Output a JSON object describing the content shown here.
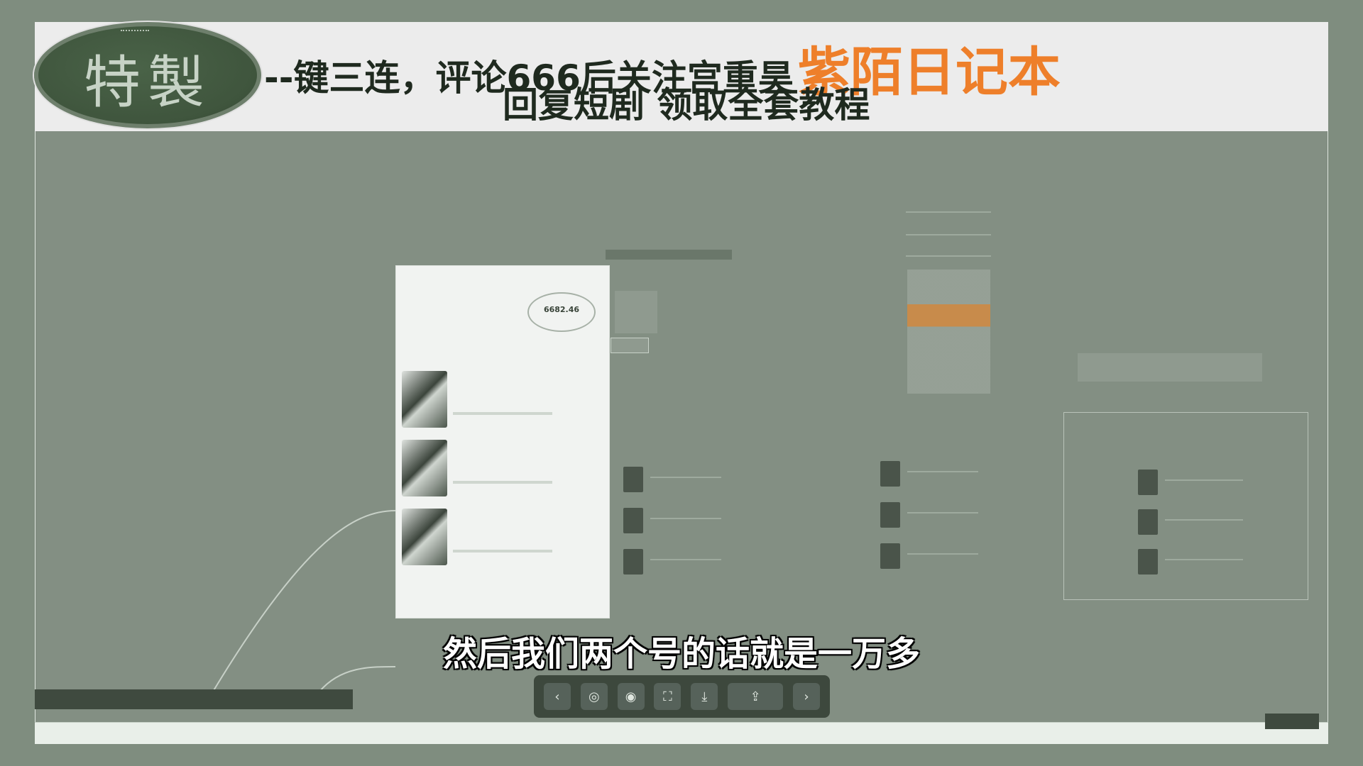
{
  "header": {
    "badge_text": "特製",
    "line1": "--键三连，评论666后关注宫重昊",
    "line1_accent": "紫陌日记本",
    "line2": "回复短剧  领取全套教程"
  },
  "phone": {
    "stats": {
      "right_value": "6682.46"
    }
  },
  "subtitle": "然后我们两个号的话就是一万多",
  "colors": {
    "accent": "#ee7f2a",
    "badge_green": "#3f553d",
    "background": "#7f8d7f",
    "header_bg": "#ececec"
  },
  "toolbar": {
    "icons": [
      "chevron-left-icon",
      "target-icon",
      "record-icon",
      "fullscreen-icon",
      "download-icon",
      "share-icon",
      "chevron-right-icon"
    ]
  }
}
